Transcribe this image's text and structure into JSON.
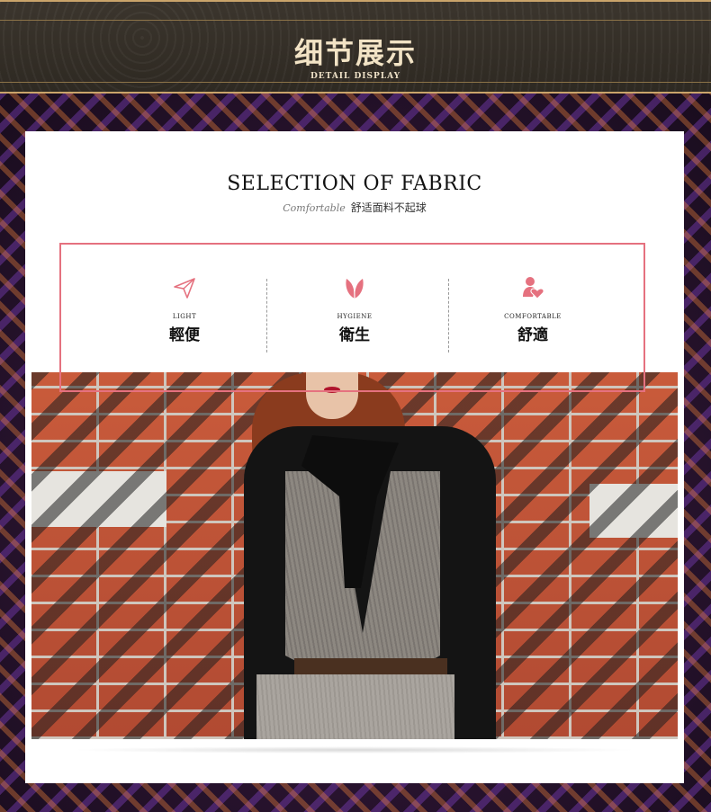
{
  "header": {
    "title": "细节展示",
    "subtitle": "DETAIL DISPLAY"
  },
  "fabric": {
    "title": "SELECTION OF FABRIC",
    "script_word": "Comfortable",
    "subtitle": "舒适面料不起球"
  },
  "features": [
    {
      "en": "LIGHT",
      "cn": "輕便",
      "icon": "paper-plane-icon"
    },
    {
      "en": "HYGIENE",
      "cn": "衛生",
      "icon": "leaf-icon"
    },
    {
      "en": "COMFORTABLE",
      "cn": "舒適",
      "icon": "person-heart-icon"
    }
  ],
  "colors": {
    "accent": "#e5717f",
    "header_bg": "#332e27",
    "header_text": "#f2e3c5",
    "gold_rule": "#caa46a"
  }
}
